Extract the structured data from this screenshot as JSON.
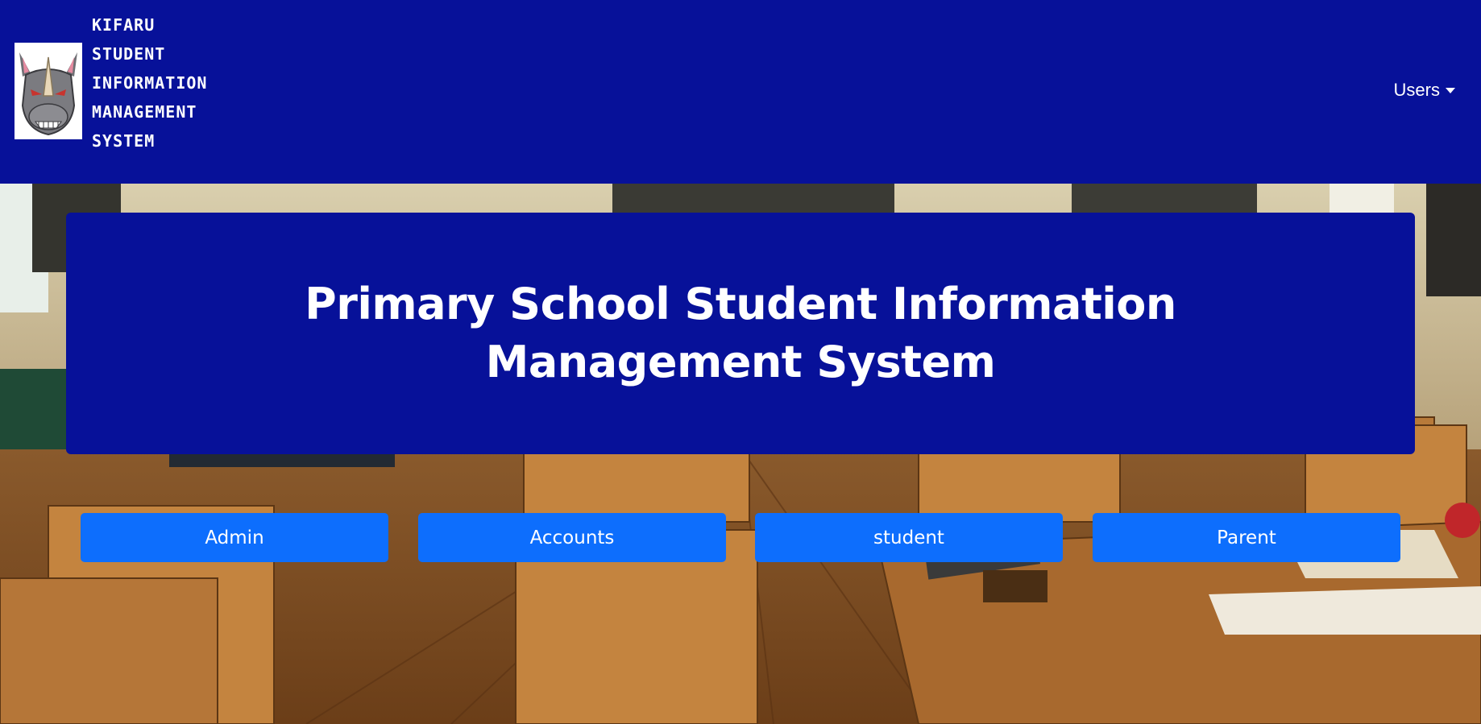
{
  "brand": {
    "lines": [
      "KIFARU",
      "STUDENT",
      "INFORMATION",
      "MANAGEMENT",
      "SYSTEM"
    ],
    "logo_icon": "rhino-head-icon"
  },
  "nav": {
    "users_label": "Users",
    "users_icon": "caret-down-icon"
  },
  "hero": {
    "title": "Primary School Student Information Management System",
    "background": "classroom-photo"
  },
  "roles": [
    {
      "label": "Admin"
    },
    {
      "label": "Accounts"
    },
    {
      "label": "student"
    },
    {
      "label": "Parent"
    }
  ],
  "colors": {
    "navbar": "#071199",
    "jumbotron": "#071199",
    "button": "#0d6efd",
    "text": "#ffffff"
  }
}
